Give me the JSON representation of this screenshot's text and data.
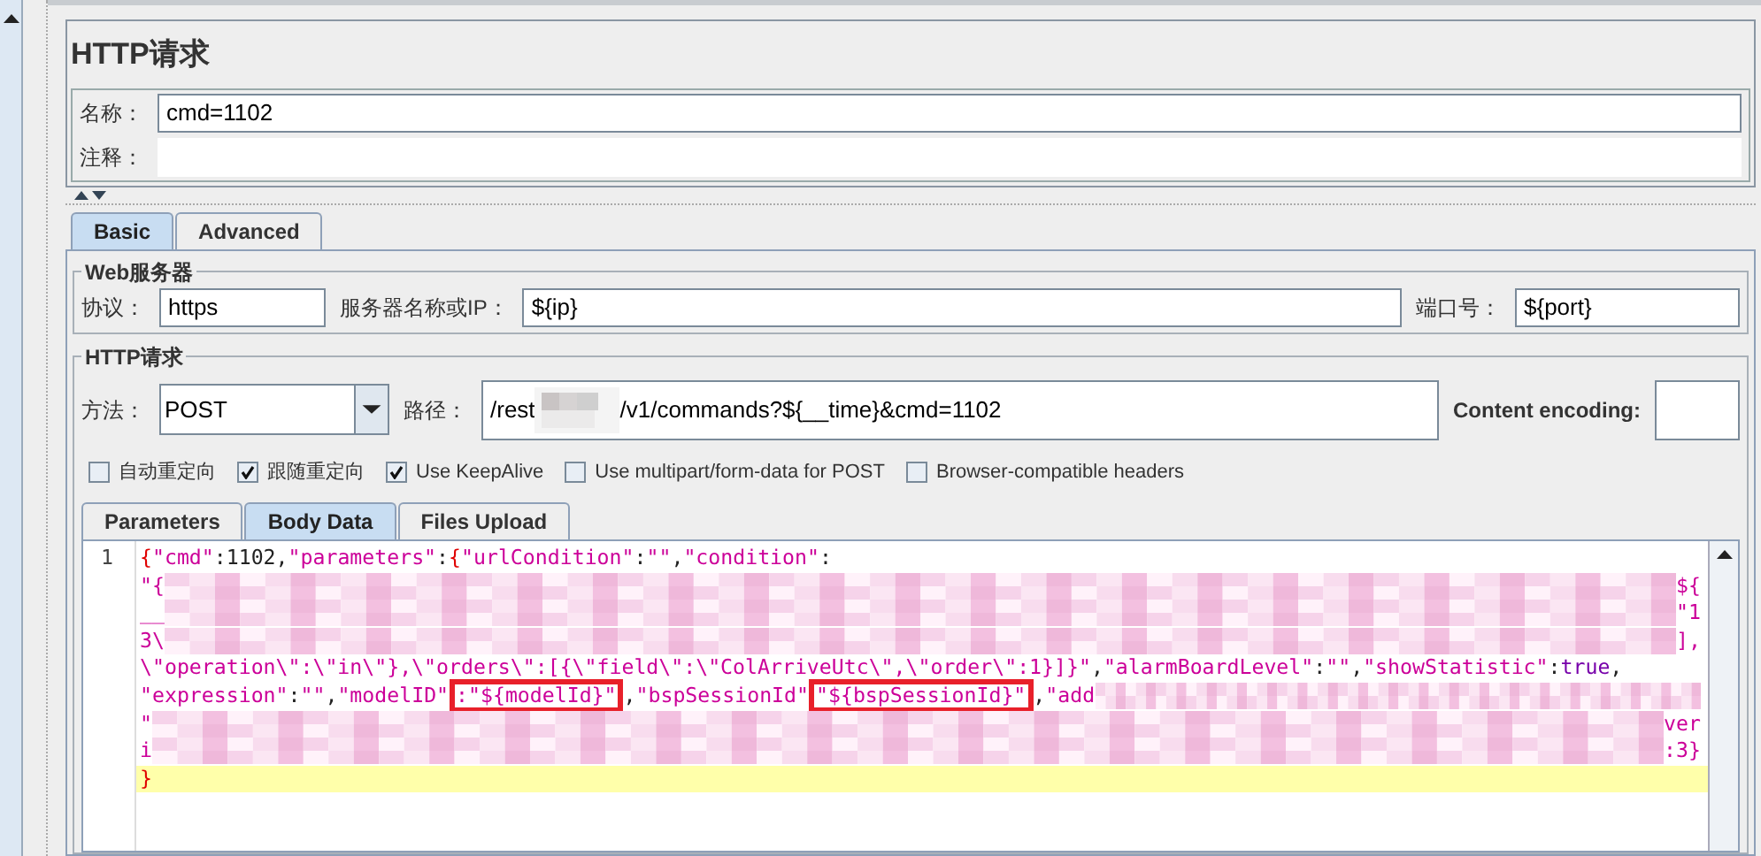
{
  "title": "HTTP请求",
  "name_field": {
    "label": "名称：",
    "value": "cmd=1102"
  },
  "comment_field": {
    "label": "注释："
  },
  "tabs": [
    {
      "label": "Basic",
      "selected": true
    },
    {
      "label": "Advanced",
      "selected": false
    }
  ],
  "web_server": {
    "legend": "Web服务器",
    "protocol": {
      "label": "协议：",
      "value": "https"
    },
    "server": {
      "label": "服务器名称或IP：",
      "value": "${ip}"
    },
    "port": {
      "label": "端口号：",
      "value": "${port}"
    }
  },
  "http_request": {
    "legend": "HTTP请求",
    "method": {
      "label": "方法：",
      "value": "POST"
    },
    "path": {
      "label": "路径：",
      "prefix": "/rest",
      "value": "/v1/commands?${__time}&cmd=1102"
    },
    "content_encoding": {
      "label": "Content encoding:"
    }
  },
  "options": [
    {
      "label": "自动重定向",
      "checked": false
    },
    {
      "label": "跟随重定向",
      "checked": true
    },
    {
      "label": "Use KeepAlive",
      "checked": true
    },
    {
      "label": "Use multipart/form-data for POST",
      "checked": false
    },
    {
      "label": "Browser-compatible headers",
      "checked": false
    }
  ],
  "body_tabs": [
    {
      "label": "Parameters",
      "selected": false
    },
    {
      "label": "Body Data",
      "selected": true
    },
    {
      "label": "Files Upload",
      "selected": false
    }
  ],
  "editor": {
    "line_number": "1",
    "lines": [
      {
        "current": false,
        "parts": [
          {
            "kind": "brace",
            "text": "{"
          },
          {
            "kind": "string",
            "text": "\"cmd\""
          },
          {
            "kind": "plain",
            "text": ":1102,"
          },
          {
            "kind": "string",
            "text": "\"parameters\""
          },
          {
            "kind": "plain",
            "text": ":"
          },
          {
            "kind": "brace",
            "text": "{"
          },
          {
            "kind": "string",
            "text": "\"urlCondition\""
          },
          {
            "kind": "plain",
            "text": ":"
          },
          {
            "kind": "string",
            "text": "\"\""
          },
          {
            "kind": "plain",
            "text": ","
          },
          {
            "kind": "string",
            "text": "\"condition\""
          },
          {
            "kind": "plain",
            "text": ":"
          }
        ]
      },
      {
        "current": false,
        "parts": [
          {
            "kind": "string",
            "text": "\"{"
          },
          {
            "kind": "blur"
          },
          {
            "kind": "string",
            "text": "${"
          }
        ]
      },
      {
        "current": false,
        "parts": [
          {
            "kind": "string",
            "text": "__"
          },
          {
            "kind": "blur"
          },
          {
            "kind": "string",
            "text": "\"1"
          }
        ]
      },
      {
        "current": false,
        "parts": [
          {
            "kind": "string",
            "text": "3\\"
          },
          {
            "kind": "blur"
          },
          {
            "kind": "string",
            "text": "],"
          }
        ]
      },
      {
        "current": false,
        "parts": [
          {
            "kind": "string",
            "text": "\\\"operation\\\":\\\"in\\\"},\\\"orders\\\":[{\\\"field\\\":\\\"ColArriveUtc\\\",\\\"order\\\":1}]}\""
          },
          {
            "kind": "plain",
            "text": ","
          },
          {
            "kind": "string",
            "text": "\"alarmBoardLevel\""
          },
          {
            "kind": "plain",
            "text": ":"
          },
          {
            "kind": "string",
            "text": "\"\""
          },
          {
            "kind": "plain",
            "text": ","
          },
          {
            "kind": "string",
            "text": "\"showStatistic\""
          },
          {
            "kind": "plain",
            "text": ":"
          },
          {
            "kind": "keyword",
            "text": "true"
          },
          {
            "kind": "plain",
            "text": ","
          }
        ]
      },
      {
        "current": false,
        "parts": [
          {
            "kind": "string",
            "text": "\"expression\""
          },
          {
            "kind": "plain",
            "text": ":"
          },
          {
            "kind": "string",
            "text": "\"\""
          },
          {
            "kind": "plain",
            "text": ","
          },
          {
            "kind": "string",
            "text": "\"modelID\""
          },
          {
            "kind": "marked",
            "text": ":\"${modelId}\""
          },
          {
            "kind": "plain",
            "text": ","
          },
          {
            "kind": "string",
            "text": "\"bspSessionId\""
          },
          {
            "kind": "marked",
            "text": "\"${bspSessionId}\""
          },
          {
            "kind": "plain",
            "text": ","
          },
          {
            "kind": "string",
            "text": "\"add"
          },
          {
            "kind": "blur"
          }
        ]
      },
      {
        "current": false,
        "parts": [
          {
            "kind": "string",
            "text": "\""
          },
          {
            "kind": "blur"
          },
          {
            "kind": "string",
            "text": "ver"
          }
        ]
      },
      {
        "current": false,
        "parts": [
          {
            "kind": "string",
            "text": "i"
          },
          {
            "kind": "blur"
          },
          {
            "kind": "string",
            "text": ":3}"
          }
        ]
      },
      {
        "current": true,
        "parts": [
          {
            "kind": "brace",
            "text": "}"
          }
        ]
      }
    ]
  }
}
